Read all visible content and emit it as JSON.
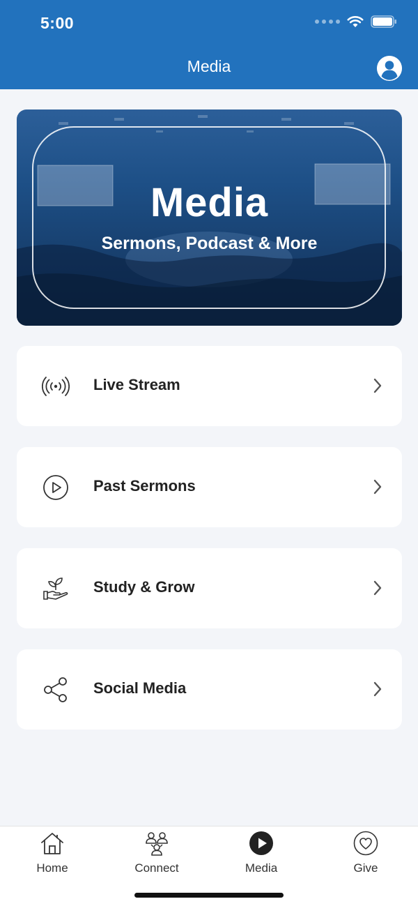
{
  "status_bar": {
    "time": "5:00"
  },
  "header": {
    "title": "Media",
    "profile_icon": "person-circle-icon"
  },
  "hero": {
    "title": "Media",
    "subtitle": "Sermons, Podcast & More",
    "background_color": "#1d4f86"
  },
  "menu": [
    {
      "label": "Live Stream",
      "icon": "broadcast-icon"
    },
    {
      "label": "Past Sermons",
      "icon": "play-circle-icon"
    },
    {
      "label": "Study & Grow",
      "icon": "hand-plant-icon"
    },
    {
      "label": "Social Media",
      "icon": "share-icon"
    }
  ],
  "tabs": [
    {
      "label": "Home",
      "icon": "house-icon",
      "active": false
    },
    {
      "label": "Connect",
      "icon": "people-icon",
      "active": false
    },
    {
      "label": "Media",
      "icon": "play-circle-filled-icon",
      "active": true
    },
    {
      "label": "Give",
      "icon": "heart-circle-icon",
      "active": false
    }
  ],
  "colors": {
    "accent": "#2272bd",
    "background": "#f3f5f9",
    "card": "#ffffff"
  }
}
